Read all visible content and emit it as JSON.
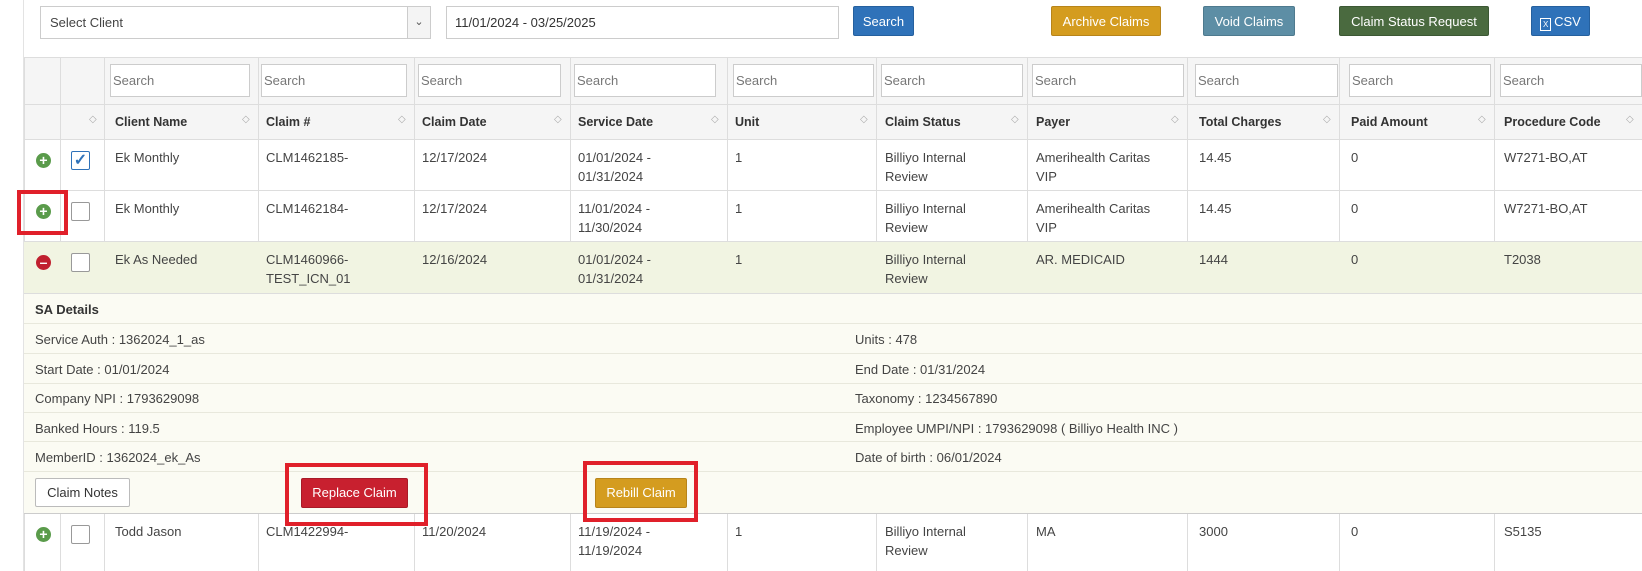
{
  "toolbar": {
    "client_select": "Select Client",
    "date_range": "11/01/2024 - 03/25/2025",
    "search": "Search",
    "archive": "Archive Claims",
    "void": "Void Claims",
    "status_request": "Claim Status Request",
    "csv": "CSV"
  },
  "filters": {
    "placeholder": "Search"
  },
  "columns": [
    "Client Name",
    "Claim #",
    "Claim Date",
    "Service Date",
    "Unit",
    "Claim Status",
    "Payer",
    "Total Charges",
    "Paid Amount",
    "Procedure Code"
  ],
  "rows": [
    {
      "client": "Ek Monthly",
      "claim_l1": "CLM1462185-",
      "claim_l2": "",
      "claim_date": "12/17/2024",
      "svc_l1": "01/01/2024 -",
      "svc_l2": "01/31/2024",
      "unit": "1",
      "status_l1": "Billiyo Internal",
      "status_l2": "Review",
      "payer_l1": "Amerihealth Caritas",
      "payer_l2": "VIP",
      "total": "14.45",
      "paid": "0",
      "proc": "W7271-BO,AT"
    },
    {
      "client": "Ek Monthly",
      "claim_l1": "CLM1462184-",
      "claim_l2": "",
      "claim_date": "12/17/2024",
      "svc_l1": "11/01/2024 -",
      "svc_l2": "11/30/2024",
      "unit": "1",
      "status_l1": "Billiyo Internal",
      "status_l2": "Review",
      "payer_l1": "Amerihealth Caritas",
      "payer_l2": "VIP",
      "total": "14.45",
      "paid": "0",
      "proc": "W7271-BO,AT"
    },
    {
      "client": "Ek As Needed",
      "claim_l1": "CLM1460966-",
      "claim_l2": "TEST_ICN_01",
      "claim_date": "12/16/2024",
      "svc_l1": "01/01/2024 -",
      "svc_l2": "01/31/2024",
      "unit": "1",
      "status_l1": "Billiyo Internal",
      "status_l2": "Review",
      "payer_l1": "AR. MEDICAID",
      "payer_l2": "",
      "total": "1444",
      "paid": "0",
      "proc": "T2038"
    },
    {
      "client": "Todd Jason",
      "claim_l1": "CLM1422994-",
      "claim_l2": "",
      "claim_date": "11/20/2024",
      "svc_l1": "11/19/2024 -",
      "svc_l2": "11/19/2024",
      "unit": "1",
      "status_l1": "Billiyo Internal",
      "status_l2": "Review",
      "payer_l1": "MA",
      "payer_l2": "",
      "total": "3000",
      "paid": "0",
      "proc": "S5135"
    }
  ],
  "details": {
    "title": "SA Details",
    "service_auth": "Service Auth : 1362024_1_as",
    "units": "Units : 478",
    "start_date": "Start Date : 01/01/2024",
    "end_date": "End Date : 01/31/2024",
    "company_npi": "Company NPI : 1793629098",
    "taxonomy": "Taxonomy : 1234567890",
    "banked_hours": "Banked Hours : 119.5",
    "employee_npi": "Employee UMPI/NPI : 1793629098 ( Billiyo Health INC )",
    "member_id": "MemberID : 1362024_ek_As",
    "dob": "Date of birth : 06/01/2024",
    "notes_btn": "Claim Notes",
    "replace_btn": "Replace Claim",
    "rebill_btn": "Rebill Claim"
  },
  "colors": {
    "highlight_row": "#f1f4e2",
    "details_bg": "#fbfbf3",
    "annotation": "#e0202a"
  }
}
